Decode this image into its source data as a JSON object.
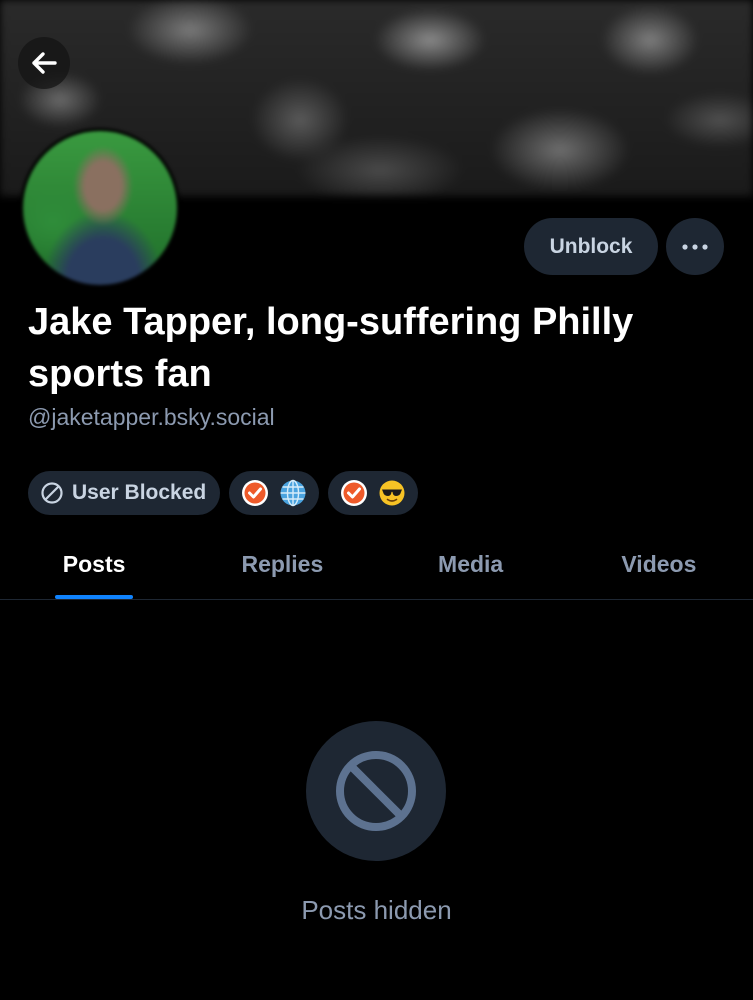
{
  "profile": {
    "display_name": "Jake Tapper, long-suffering Philly sports fan",
    "handle": "@jaketapper.bsky.social"
  },
  "actions": {
    "unblock_label": "Unblock"
  },
  "badges": {
    "blocked_label": "User Blocked",
    "labels": [
      {
        "icons": [
          "check-shield-icon",
          "globe-icon"
        ],
        "emoji": "🌐"
      },
      {
        "icons": [
          "check-shield-icon",
          "sunglasses-icon"
        ],
        "emoji": "😎"
      }
    ]
  },
  "tabs": [
    {
      "label": "Posts",
      "active": true
    },
    {
      "label": "Replies",
      "active": false
    },
    {
      "label": "Media",
      "active": false
    },
    {
      "label": "Videos",
      "active": false
    }
  ],
  "feed": {
    "empty_message": "Posts hidden"
  },
  "colors": {
    "accent": "#1083fe",
    "pill_bg": "#1e2733",
    "muted_text": "#8c9ab0",
    "badge_orange": "#ee5a2a"
  }
}
